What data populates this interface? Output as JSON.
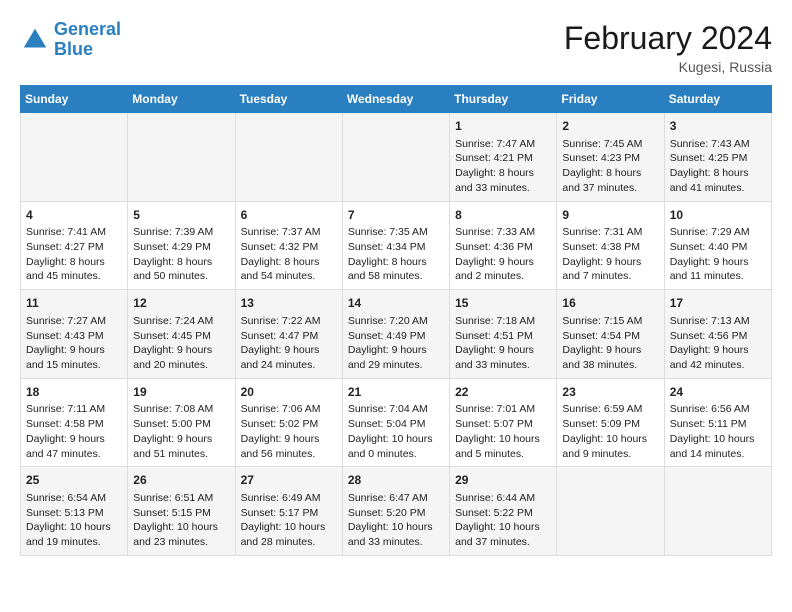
{
  "header": {
    "logo_line1": "General",
    "logo_line2": "Blue",
    "month_title": "February 2024",
    "location": "Kugesi, Russia"
  },
  "days_of_week": [
    "Sunday",
    "Monday",
    "Tuesday",
    "Wednesday",
    "Thursday",
    "Friday",
    "Saturday"
  ],
  "weeks": [
    [
      {
        "day": "",
        "content": ""
      },
      {
        "day": "",
        "content": ""
      },
      {
        "day": "",
        "content": ""
      },
      {
        "day": "",
        "content": ""
      },
      {
        "day": "1",
        "content": "Sunrise: 7:47 AM\nSunset: 4:21 PM\nDaylight: 8 hours\nand 33 minutes."
      },
      {
        "day": "2",
        "content": "Sunrise: 7:45 AM\nSunset: 4:23 PM\nDaylight: 8 hours\nand 37 minutes."
      },
      {
        "day": "3",
        "content": "Sunrise: 7:43 AM\nSunset: 4:25 PM\nDaylight: 8 hours\nand 41 minutes."
      }
    ],
    [
      {
        "day": "4",
        "content": "Sunrise: 7:41 AM\nSunset: 4:27 PM\nDaylight: 8 hours\nand 45 minutes."
      },
      {
        "day": "5",
        "content": "Sunrise: 7:39 AM\nSunset: 4:29 PM\nDaylight: 8 hours\nand 50 minutes."
      },
      {
        "day": "6",
        "content": "Sunrise: 7:37 AM\nSunset: 4:32 PM\nDaylight: 8 hours\nand 54 minutes."
      },
      {
        "day": "7",
        "content": "Sunrise: 7:35 AM\nSunset: 4:34 PM\nDaylight: 8 hours\nand 58 minutes."
      },
      {
        "day": "8",
        "content": "Sunrise: 7:33 AM\nSunset: 4:36 PM\nDaylight: 9 hours\nand 2 minutes."
      },
      {
        "day": "9",
        "content": "Sunrise: 7:31 AM\nSunset: 4:38 PM\nDaylight: 9 hours\nand 7 minutes."
      },
      {
        "day": "10",
        "content": "Sunrise: 7:29 AM\nSunset: 4:40 PM\nDaylight: 9 hours\nand 11 minutes."
      }
    ],
    [
      {
        "day": "11",
        "content": "Sunrise: 7:27 AM\nSunset: 4:43 PM\nDaylight: 9 hours\nand 15 minutes."
      },
      {
        "day": "12",
        "content": "Sunrise: 7:24 AM\nSunset: 4:45 PM\nDaylight: 9 hours\nand 20 minutes."
      },
      {
        "day": "13",
        "content": "Sunrise: 7:22 AM\nSunset: 4:47 PM\nDaylight: 9 hours\nand 24 minutes."
      },
      {
        "day": "14",
        "content": "Sunrise: 7:20 AM\nSunset: 4:49 PM\nDaylight: 9 hours\nand 29 minutes."
      },
      {
        "day": "15",
        "content": "Sunrise: 7:18 AM\nSunset: 4:51 PM\nDaylight: 9 hours\nand 33 minutes."
      },
      {
        "day": "16",
        "content": "Sunrise: 7:15 AM\nSunset: 4:54 PM\nDaylight: 9 hours\nand 38 minutes."
      },
      {
        "day": "17",
        "content": "Sunrise: 7:13 AM\nSunset: 4:56 PM\nDaylight: 9 hours\nand 42 minutes."
      }
    ],
    [
      {
        "day": "18",
        "content": "Sunrise: 7:11 AM\nSunset: 4:58 PM\nDaylight: 9 hours\nand 47 minutes."
      },
      {
        "day": "19",
        "content": "Sunrise: 7:08 AM\nSunset: 5:00 PM\nDaylight: 9 hours\nand 51 minutes."
      },
      {
        "day": "20",
        "content": "Sunrise: 7:06 AM\nSunset: 5:02 PM\nDaylight: 9 hours\nand 56 minutes."
      },
      {
        "day": "21",
        "content": "Sunrise: 7:04 AM\nSunset: 5:04 PM\nDaylight: 10 hours\nand 0 minutes."
      },
      {
        "day": "22",
        "content": "Sunrise: 7:01 AM\nSunset: 5:07 PM\nDaylight: 10 hours\nand 5 minutes."
      },
      {
        "day": "23",
        "content": "Sunrise: 6:59 AM\nSunset: 5:09 PM\nDaylight: 10 hours\nand 9 minutes."
      },
      {
        "day": "24",
        "content": "Sunrise: 6:56 AM\nSunset: 5:11 PM\nDaylight: 10 hours\nand 14 minutes."
      }
    ],
    [
      {
        "day": "25",
        "content": "Sunrise: 6:54 AM\nSunset: 5:13 PM\nDaylight: 10 hours\nand 19 minutes."
      },
      {
        "day": "26",
        "content": "Sunrise: 6:51 AM\nSunset: 5:15 PM\nDaylight: 10 hours\nand 23 minutes."
      },
      {
        "day": "27",
        "content": "Sunrise: 6:49 AM\nSunset: 5:17 PM\nDaylight: 10 hours\nand 28 minutes."
      },
      {
        "day": "28",
        "content": "Sunrise: 6:47 AM\nSunset: 5:20 PM\nDaylight: 10 hours\nand 33 minutes."
      },
      {
        "day": "29",
        "content": "Sunrise: 6:44 AM\nSunset: 5:22 PM\nDaylight: 10 hours\nand 37 minutes."
      },
      {
        "day": "",
        "content": ""
      },
      {
        "day": "",
        "content": ""
      }
    ]
  ]
}
